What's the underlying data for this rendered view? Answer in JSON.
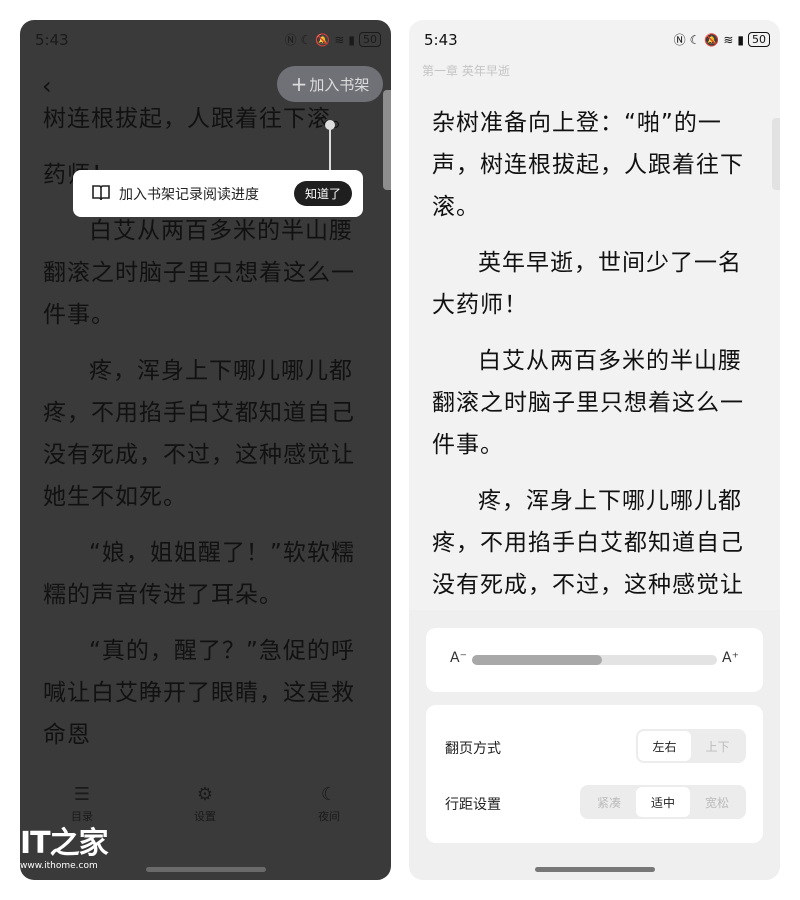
{
  "status": {
    "time": "5:43",
    "battery": "50"
  },
  "left": {
    "add_shelf_label": "加入书架",
    "tooltip_text": "加入书架记录阅读进度",
    "tooltip_button": "知道了",
    "paragraphs": [
      "树连根拔起，人跟着往下滚。",
      "药师！",
      "白艾从两百多米的半山腰翻滚之时脑子里只想着这么一件事。",
      "疼，浑身上下哪儿哪儿都疼，不用掐手白艾都知道自己没有死成，不过，这种感觉让她生不如死。",
      "“娘，姐姐醒了！”软软糯糯的声音传进了耳朵。",
      "“真的，醒了？”急促的呼喊让白艾睁开了眼睛，这是救命恩"
    ],
    "nav": {
      "contents": "目录",
      "settings": "设置",
      "night": "夜间"
    }
  },
  "right": {
    "chapter_title": "第一章 英年早逝",
    "paragraphs": [
      "杂树准备向上登：“啪”的一声，树连根拔起，人跟着往下滚。",
      "英年早逝，世间少了一名大药师！",
      "白艾从两百多米的半山腰翻滚之时脑子里只想着这么一件事。",
      "疼，浑身上下哪儿哪儿都疼，不用掐手白艾都知道自己没有死成，不过，这种感觉让她生不如死。"
    ],
    "font_small": "A⁻",
    "font_large": "A⁺",
    "font_size_level": 0.53,
    "page_turn_label": "翻页方式",
    "page_turn_options": [
      "左右",
      "上下"
    ],
    "spacing_label": "行距设置",
    "spacing_options": [
      "紧凑",
      "适中",
      "宽松"
    ]
  },
  "watermark": {
    "logo": "IT之家",
    "url": "www.ithome.com"
  }
}
